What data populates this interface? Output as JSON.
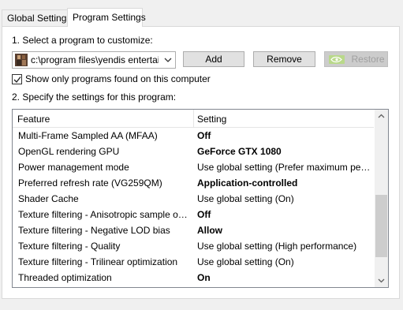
{
  "tabs": [
    {
      "label": "Global Settings",
      "active": false
    },
    {
      "label": "Program Settings",
      "active": true
    }
  ],
  "step1": {
    "label": "1. Select a program to customize:"
  },
  "program_select": {
    "value": "c:\\program files\\yendis entertai...",
    "icon": "program-icon"
  },
  "buttons": {
    "add": "Add",
    "remove": "Remove",
    "restore": "Restore"
  },
  "checkbox": {
    "label": "Show only programs found on this computer",
    "checked": true
  },
  "step2": {
    "label": "2. Specify the settings for this program:"
  },
  "table": {
    "headers": {
      "feature": "Feature",
      "setting": "Setting"
    },
    "rows": [
      {
        "feature": "Multi-Frame Sampled AA (MFAA)",
        "setting": "Off",
        "bold": true
      },
      {
        "feature": "OpenGL rendering GPU",
        "setting": "GeForce GTX 1080",
        "bold": true
      },
      {
        "feature": "Power management mode",
        "setting": "Use global setting (Prefer maximum perfor...",
        "bold": false
      },
      {
        "feature": "Preferred refresh rate (VG259QM)",
        "setting": "Application-controlled",
        "bold": true
      },
      {
        "feature": "Shader Cache",
        "setting": "Use global setting (On)",
        "bold": false
      },
      {
        "feature": "Texture filtering - Anisotropic sample opti...",
        "setting": "Off",
        "bold": true
      },
      {
        "feature": "Texture filtering - Negative LOD bias",
        "setting": "Allow",
        "bold": true
      },
      {
        "feature": "Texture filtering - Quality",
        "setting": "Use global setting (High performance)",
        "bold": false
      },
      {
        "feature": "Texture filtering - Trilinear optimization",
        "setting": "Use global setting (On)",
        "bold": false
      },
      {
        "feature": "Threaded optimization",
        "setting": "On",
        "bold": true
      }
    ]
  },
  "colors": {
    "nvidia_green": "#76b900"
  }
}
